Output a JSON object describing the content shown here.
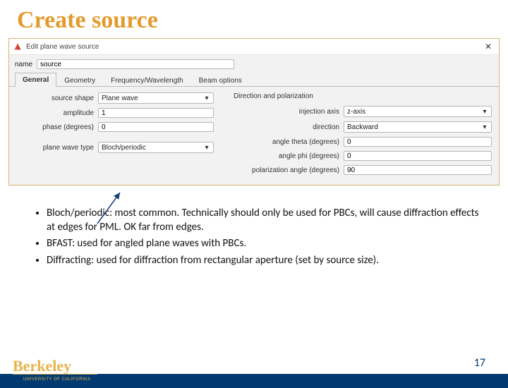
{
  "slide": {
    "title": "Create source",
    "page_number": "17",
    "university": "UNIVERSITY OF CALIFORNIA",
    "wordmark": "Berkeley"
  },
  "window": {
    "title": "Edit plane wave source",
    "close_glyph": "✕",
    "name_label": "name",
    "name_value": "source"
  },
  "tabs": {
    "general": "General",
    "geometry": "Geometry",
    "freq": "Frequency/Wavelength",
    "beam": "Beam options"
  },
  "left": {
    "shape_label": "source shape",
    "shape_value": "Plane wave",
    "amplitude_label": "amplitude",
    "amplitude_value": "1",
    "phase_label": "phase (degrees)",
    "phase_value": "0",
    "pwtype_label": "plane wave type",
    "pwtype_value": "Bloch/periodic"
  },
  "right": {
    "section": "Direction and polarization",
    "axis_label": "injection axis",
    "axis_value": "z-axis",
    "dir_label": "direction",
    "dir_value": "Backward",
    "theta_label": "angle theta (degrees)",
    "theta_value": "0",
    "phi_label": "angle phi (degrees)",
    "phi_value": "0",
    "pol_label": "polarization angle (degrees)",
    "pol_value": "90"
  },
  "notes": {
    "b1": "Bloch/periodic: most common. Technically should only be used for PBCs, will cause diffraction effects at edges for PML. OK far from edges.",
    "b2": "BFAST: used for angled plane waves with PBCs.",
    "b3": "Diffracting: used for diffraction from rectangular aperture (set by source size)."
  }
}
